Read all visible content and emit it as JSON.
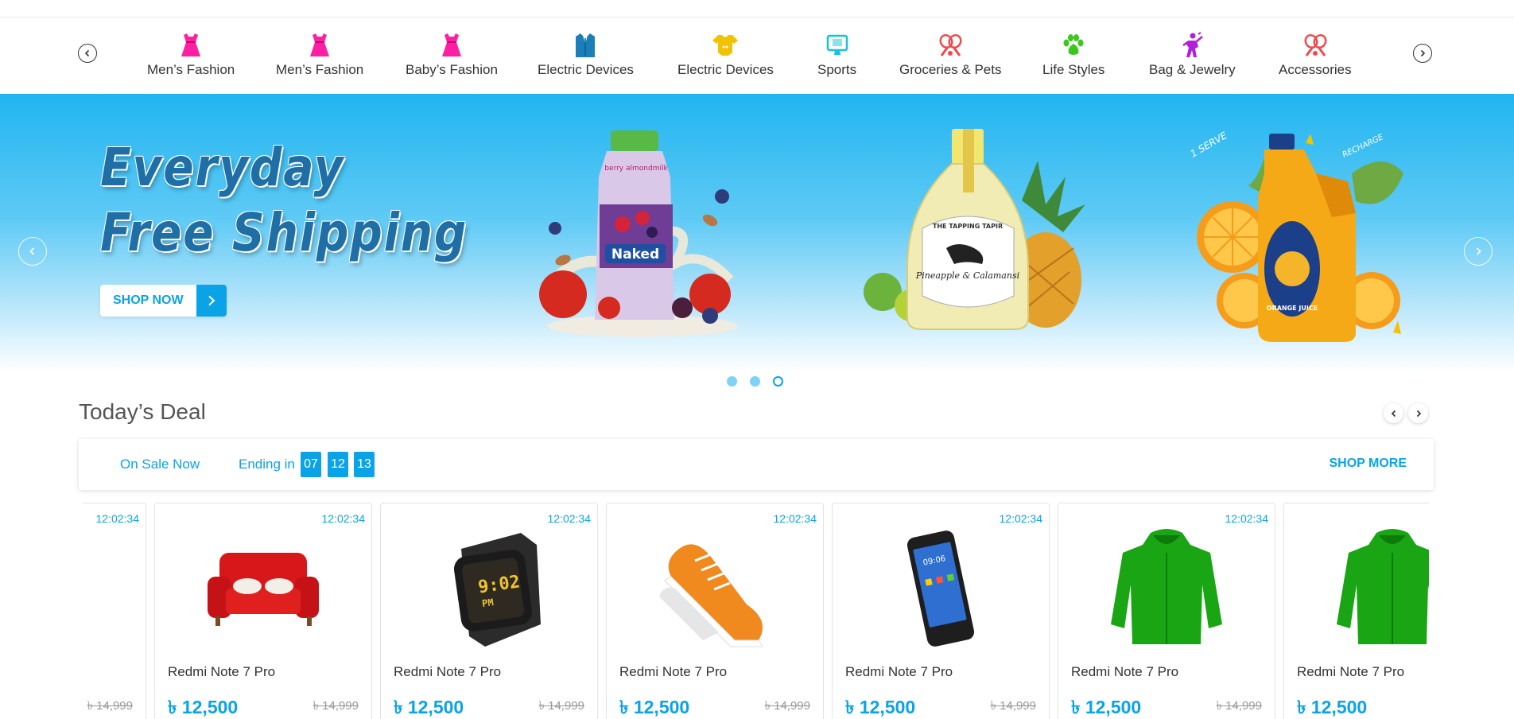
{
  "categories": {
    "prev_icon": "chevron-left-icon",
    "next_icon": "chevron-right-icon",
    "items": [
      {
        "label": "Men’s Fashion",
        "icon": "dress-icon",
        "color": "#ff1fa3"
      },
      {
        "label": "Men’s Fashion",
        "icon": "dress-icon",
        "color": "#ff1fa3"
      },
      {
        "label": "Baby’s Fashion",
        "icon": "dress-icon",
        "color": "#ff1fa3"
      },
      {
        "label": "Electric Devices",
        "icon": "suit-icon",
        "color": "#1a7fb8"
      },
      {
        "label": "Electric Devices",
        "icon": "baby-onesie-icon",
        "color": "#f2c200"
      },
      {
        "label": "Sports",
        "icon": "monitor-icon",
        "color": "#18c3d9"
      },
      {
        "label": "Groceries & Pets",
        "icon": "badminton-icon",
        "color": "#ee4a4a"
      },
      {
        "label": "Life Styles",
        "icon": "paw-icon",
        "color": "#39c81b"
      },
      {
        "label": "Bag & Jewelry",
        "icon": "dancer-icon",
        "color": "#b21fd8"
      },
      {
        "label": "Accessories",
        "icon": "badminton-icon",
        "color": "#ee4a4a"
      }
    ]
  },
  "hero": {
    "title_line1": "Everyday",
    "title_line2": "Free Shipping",
    "cta_label": "SHOP NOW",
    "products": [
      {
        "name": "berry almondmilk",
        "brand": "Naked",
        "icon": "juice-bottle-icon"
      },
      {
        "name": "Pineapple & Calamansi",
        "brand": "THE TAPPING TAPIR",
        "icon": "glass-bottle-icon"
      },
      {
        "name": "ORANGE JUICE",
        "brand": "",
        "icon": "juice-jug-icon"
      }
    ],
    "slides_total": 3,
    "active_slide": 3,
    "accent": "#0ba3e8"
  },
  "deal": {
    "title": "Today’s Deal",
    "on_sale_label": "On Sale Now",
    "ending_label": "Ending in",
    "timer": [
      "07",
      "12",
      "13"
    ],
    "shop_more_label": "SHOP MORE"
  },
  "products": [
    {
      "time": "12:02:34",
      "name": "",
      "price": "",
      "old_price": "৳ 14,999",
      "image": "watch-icon"
    },
    {
      "time": "12:02:34",
      "name": "Redmi Note 7 Pro",
      "price": "৳ 12,500",
      "old_price": "৳ 14,999",
      "image": "sofa-icon"
    },
    {
      "time": "12:02:34",
      "name": "Redmi Note 7 Pro",
      "price": "৳ 12,500",
      "old_price": "৳ 14,999",
      "image": "smartwatch-icon"
    },
    {
      "time": "12:02:34",
      "name": "Redmi Note 7 Pro",
      "price": "৳ 12,500",
      "old_price": "৳ 14,999",
      "image": "sneaker-icon"
    },
    {
      "time": "12:02:34",
      "name": "Redmi Note 7 Pro",
      "price": "৳ 12,500",
      "old_price": "৳ 14,999",
      "image": "smartphone-icon"
    },
    {
      "time": "12:02:34",
      "name": "Redmi Note 7 Pro",
      "price": "৳ 12,500",
      "old_price": "৳ 14,999",
      "image": "hoodie-icon"
    },
    {
      "time": "",
      "name": "Redmi Note 7 Pro",
      "price": "৳ 12,500",
      "old_price": "",
      "image": "hoodie-icon"
    }
  ]
}
